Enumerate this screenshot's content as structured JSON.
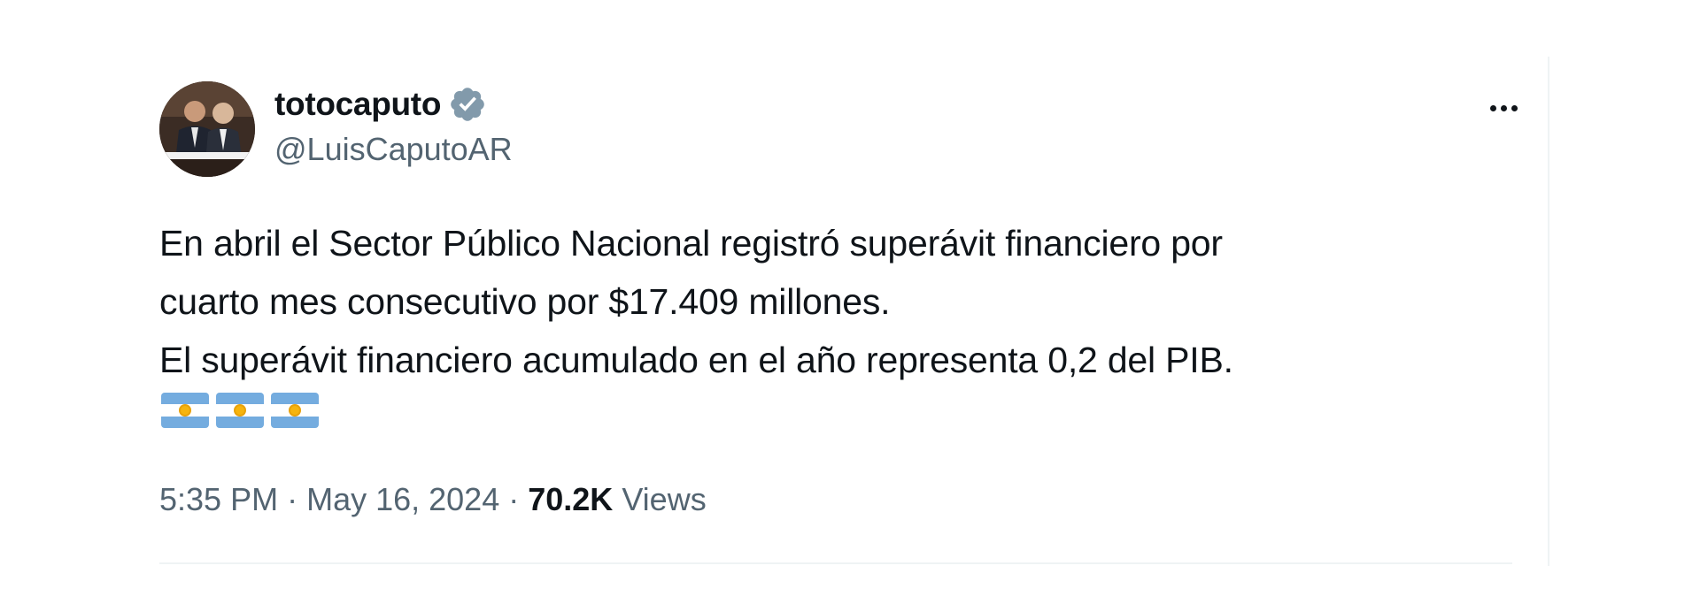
{
  "author": {
    "display_name": "totocaputo",
    "handle": "@LuisCaputoAR",
    "verified": true
  },
  "tweet": {
    "lines": [
      "En abril el Sector Público Nacional registró superávit financiero por",
      "cuarto mes consecutivo por $17.409 millones.",
      "El superávit financiero acumulado en el año representa 0,2 del PIB."
    ],
    "emoji": [
      "flag-argentina",
      "flag-argentina",
      "flag-argentina"
    ]
  },
  "meta": {
    "time": "5:35 PM",
    "separator": "·",
    "date": "May 16, 2024",
    "views_count": "70.2K",
    "views_label": "Views"
  },
  "colors": {
    "text_primary": "#0f1419",
    "text_secondary": "#536471",
    "verified_badge": "#829aab",
    "divider": "#eff3f4",
    "flag_blue": "#74acdf",
    "flag_sun": "#f6b40e"
  },
  "icons": {
    "verified": "verified-badge-icon",
    "more": "more-options-icon"
  }
}
